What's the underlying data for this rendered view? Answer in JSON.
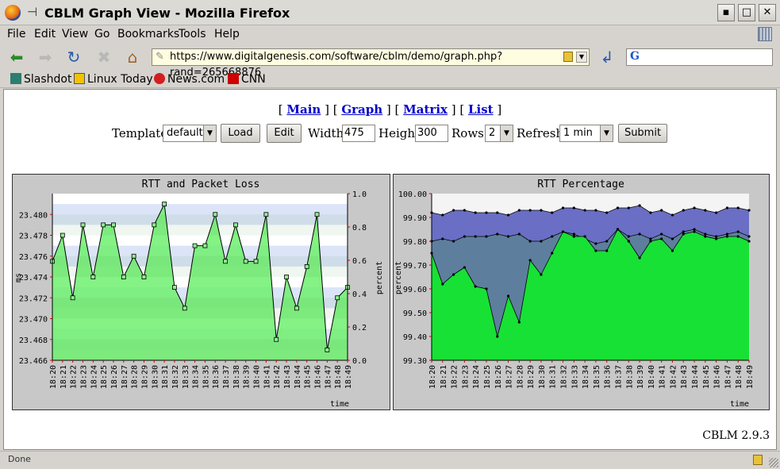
{
  "window": {
    "title": "CBLM Graph View - Mozilla Firefox",
    "minimize": "▪",
    "maximize": "□",
    "close": "✕"
  },
  "menu": {
    "items": [
      "File",
      "Edit",
      "View",
      "Go",
      "Bookmarks",
      "Tools",
      "Help"
    ]
  },
  "urlbar": {
    "url": "https://www.digitalgenesis.com/software/cblm/demo/graph.php?rand=265668876"
  },
  "search": {
    "value": ""
  },
  "bookmarks": [
    "Slashdot",
    "Linux Today",
    "News.com",
    "CNN"
  ],
  "page": {
    "nav": [
      "Main",
      "Graph",
      "Matrix",
      "List"
    ],
    "form": {
      "template_label": "Template",
      "template_value": "default",
      "load_label": "Load",
      "edit_label": "Edit",
      "width_label": "Width",
      "width_value": "475",
      "height_label": "Height",
      "height_value": "300",
      "rows_label": "Rows",
      "rows_value": "2",
      "refresh_label": "Refresh",
      "refresh_value": "1 min",
      "submit_label": "Submit"
    },
    "version": "CBLM 2.9.3"
  },
  "status": {
    "text": "Done"
  },
  "colors": {
    "green_fill": "#6ff06f",
    "band_blue": "#dce4f8",
    "pct_purple": "#6a6ec4",
    "pct_slate": "#5e7e9e",
    "pct_green": "#17e135"
  },
  "chart_data": [
    {
      "type": "line",
      "title": "RTT and Packet Loss",
      "ylabel": "ms",
      "y2label": "percent",
      "xlabel": "time",
      "x": [
        "18:20",
        "18:21",
        "18:22",
        "18:23",
        "18:24",
        "18:25",
        "18:26",
        "18:27",
        "18:28",
        "18:29",
        "18:30",
        "18:31",
        "18:32",
        "18:33",
        "18:34",
        "18:35",
        "18:36",
        "18:37",
        "18:38",
        "18:39",
        "18:40",
        "18:41",
        "18:42",
        "18:43",
        "18:44",
        "18:45",
        "18:46",
        "18:47",
        "18:48",
        "18:49"
      ],
      "ylim": [
        23.466,
        23.482
      ],
      "yticks": [
        "23.466",
        "23.468",
        "23.470",
        "23.472",
        "23.474",
        "23.476",
        "23.478",
        "23.480"
      ],
      "y2lim": [
        0,
        1
      ],
      "y2ticks": [
        "0.0",
        "0.2",
        "0.4",
        "0.6",
        "0.8",
        "1.0"
      ],
      "series": [
        {
          "values": [
            23.4755,
            23.478,
            23.472,
            23.479,
            23.474,
            23.479,
            23.479,
            23.474,
            23.476,
            23.474,
            23.479,
            23.481,
            23.473,
            23.471,
            23.477,
            23.477,
            23.48,
            23.4755,
            23.479,
            23.4755,
            23.4755,
            23.48,
            23.468,
            23.474,
            23.471,
            23.475,
            23.48,
            23.467,
            23.472,
            23.473
          ]
        }
      ]
    },
    {
      "type": "area",
      "title": "RTT Percentage",
      "ylabel": "percent",
      "xlabel": "time",
      "x": [
        "18:20",
        "18:21",
        "18:22",
        "18:23",
        "18:24",
        "18:25",
        "18:26",
        "18:27",
        "18:28",
        "18:29",
        "18:30",
        "18:31",
        "18:32",
        "18:33",
        "18:34",
        "18:35",
        "18:36",
        "18:37",
        "18:38",
        "18:39",
        "18:40",
        "18:41",
        "18:42",
        "18:43",
        "18:44",
        "18:45",
        "18:46",
        "18:47",
        "18:48",
        "18:49"
      ],
      "ylim": [
        99.3,
        100.0
      ],
      "yticks": [
        "99.30",
        "99.40",
        "99.50",
        "99.60",
        "99.70",
        "99.80",
        "99.90",
        "100.00"
      ],
      "series": [
        {
          "values": [
            99.92,
            99.91,
            99.93,
            99.93,
            99.92,
            99.92,
            99.92,
            99.91,
            99.93,
            99.93,
            99.93,
            99.92,
            99.94,
            99.94,
            99.93,
            99.93,
            99.92,
            99.94,
            99.94,
            99.95,
            99.92,
            99.93,
            99.91,
            99.93,
            99.94,
            99.93,
            99.92,
            99.94,
            99.94,
            99.93
          ]
        },
        {
          "values": [
            99.8,
            99.81,
            99.8,
            99.82,
            99.82,
            99.82,
            99.83,
            99.82,
            99.83,
            99.8,
            99.8,
            99.82,
            99.84,
            99.83,
            99.81,
            99.79,
            99.8,
            99.85,
            99.82,
            99.83,
            99.81,
            99.83,
            99.81,
            99.84,
            99.85,
            99.83,
            99.82,
            99.83,
            99.84,
            99.82
          ]
        },
        {
          "values": [
            99.75,
            99.62,
            99.66,
            99.69,
            99.61,
            99.6,
            99.4,
            99.57,
            99.46,
            99.72,
            99.66,
            99.75,
            99.84,
            99.82,
            99.82,
            99.76,
            99.76,
            99.85,
            99.8,
            99.73,
            99.8,
            99.81,
            99.76,
            99.83,
            99.84,
            99.82,
            99.81,
            99.82,
            99.82,
            99.8
          ]
        }
      ]
    }
  ]
}
